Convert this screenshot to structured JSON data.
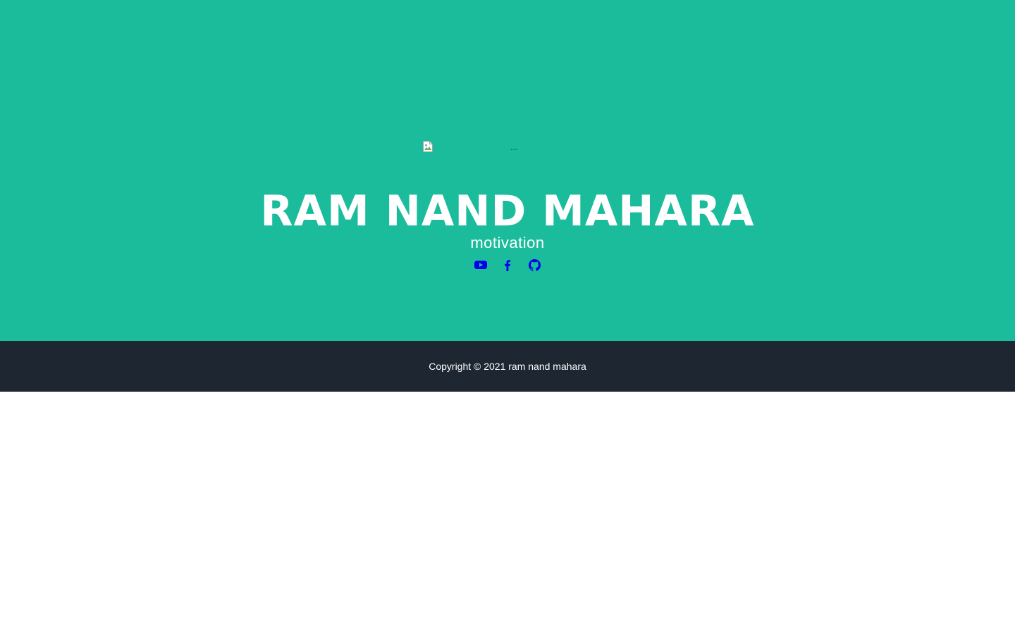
{
  "header": {
    "avatar_alt": "...",
    "title": "RAM NAND MAHARA",
    "subtitle": "motivation"
  },
  "social": {
    "icons": [
      "youtube-icon",
      "facebook-icon",
      "github-icon"
    ],
    "link_color": "#0000ee"
  },
  "footer": {
    "copyright": "Copyright © 2021 ram nand mahara"
  },
  "colors": {
    "masthead_bg": "#1abc9c",
    "footer_bg": "#1e2632",
    "text_white": "#ffffff"
  }
}
